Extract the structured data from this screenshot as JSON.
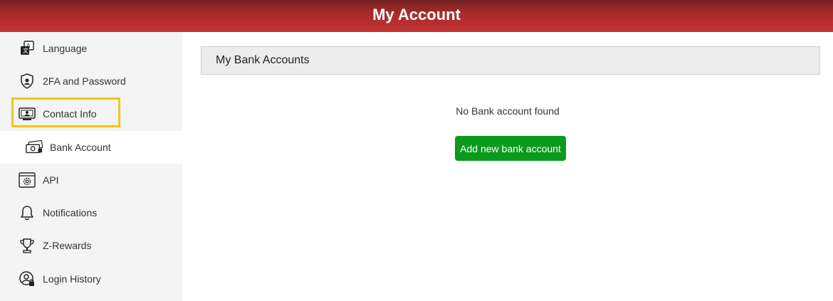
{
  "header": {
    "title": "My Account"
  },
  "sidebar": {
    "items": [
      {
        "label": "Language",
        "icon": "language-icon"
      },
      {
        "label": "2FA and Password",
        "icon": "shield-lock-icon"
      },
      {
        "label": "Contact Info",
        "icon": "contact-card-icon"
      },
      {
        "label": "Bank Account",
        "icon": "banknotes-icon",
        "active": true
      },
      {
        "label": "API",
        "icon": "api-gear-icon"
      },
      {
        "label": "Notifications",
        "icon": "bell-icon"
      },
      {
        "label": "Z-Rewards",
        "icon": "trophy-icon"
      },
      {
        "label": "Login History",
        "icon": "user-lock-icon"
      }
    ]
  },
  "main": {
    "section_title": "My Bank Accounts",
    "empty_message": "No Bank account found",
    "add_button_label": "Add new bank account"
  },
  "colors": {
    "header_red": "#c33333",
    "add_button_green": "#0b9a1e",
    "highlight_yellow": "#f5c518"
  }
}
